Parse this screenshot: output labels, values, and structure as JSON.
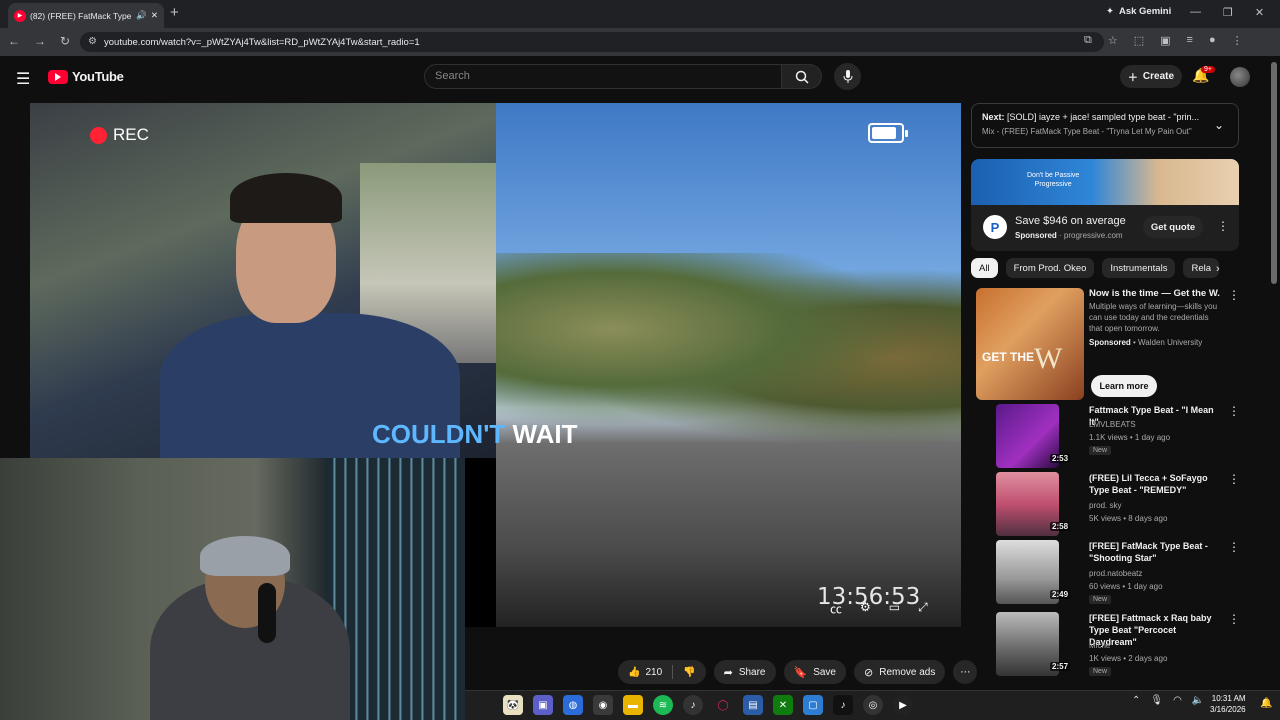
{
  "browser": {
    "tab_title": "(82) (FREE) FatMack Type B",
    "tab_badge_icon": "youtube-icon",
    "url": "youtube.com/watch?v=_pWtZYAj4Tw&list=RD_pWtZYAj4Tw&start_radio=1",
    "gemini_label": "Ask Gemini"
  },
  "youtube": {
    "logo_text": "YouTube",
    "search_placeholder": "Search",
    "create_label": "Create",
    "notifications_count": "9+"
  },
  "video": {
    "rec_label": "REC",
    "caption_word1": "COULDN'T",
    "caption_word2": "WAIT",
    "timestamp": "13:56:53"
  },
  "actions": {
    "like_count": "210",
    "share_label": "Share",
    "save_label": "Save",
    "remove_ads_label": "Remove ads"
  },
  "next": {
    "prefix": "Next:",
    "title": "[SOLD] iayze + jace! sampled type beat - \"prin...",
    "subtitle": "Mix - (FREE) FatMack Type Beat - \"Tryna Let My Pain Out\""
  },
  "ad": {
    "banner_line1": "Don't be Passive",
    "banner_line2": "Progressive",
    "title": "Save $946 on average",
    "sponsored": "Sponsored",
    "domain": "progressive.com",
    "cta": "Get quote"
  },
  "chips": [
    "All",
    "From Prod. Okeo",
    "Instrumentals",
    "Rela"
  ],
  "sponsored_item": {
    "thumb_text": "GET THE",
    "thumb_w": "W",
    "title": "Now is the time — Get the W.",
    "desc": "Multiple ways of learning—skills you can use today and the credentials that open tomorrow.",
    "sponsored": "Sponsored",
    "advertiser": "Walden University",
    "cta": "Learn more"
  },
  "recommendations": [
    {
      "title": "Fattmack Type Beat - \"I Mean It\"",
      "channel": "LMVLBEATS",
      "meta": "1.1K views • 1 day ago",
      "badge": "New",
      "duration": "2:53"
    },
    {
      "title": "(FREE) Lil Tecca + SoFaygo Type Beat - \"REMEDY\"",
      "channel": "prod. sky",
      "meta": "5K views • 8 days ago",
      "badge": "",
      "duration": "2:58"
    },
    {
      "title": "[FREE] FatMack Type Beat - \"Shooting Star\"",
      "channel": "prod.natobeatz",
      "meta": "60 views • 1 day ago",
      "badge": "New",
      "duration": "2:49"
    },
    {
      "title": "[FREE] Fattmack x Raq baby Type Beat \"Percocet Daydream\"",
      "channel": "Miche",
      "meta": "1K views • 2 days ago",
      "badge": "New",
      "duration": "2:57"
    }
  ],
  "taskbar": {
    "time": "10:31 AM",
    "date": "3/16/2026"
  }
}
